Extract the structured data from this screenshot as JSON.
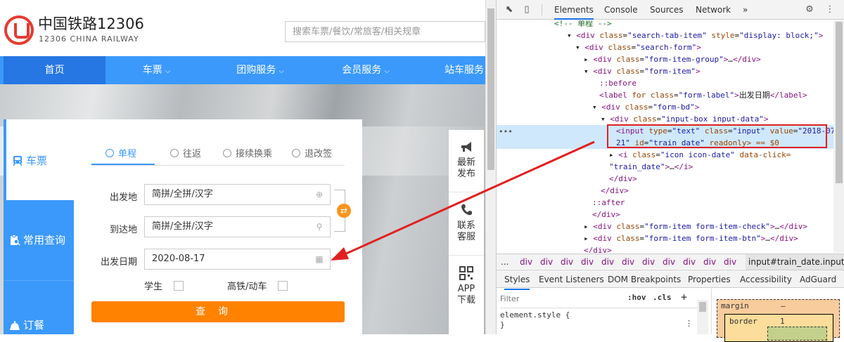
{
  "header": {
    "logo_cn": "中国铁路12306",
    "logo_en": "12306 CHINA RAILWAY",
    "search_placeholder": "搜索车票/餐饮/常旅客/相关规章"
  },
  "nav": {
    "items": [
      {
        "label": "首页",
        "chevron": false
      },
      {
        "label": "车票",
        "chevron": true
      },
      {
        "label": "团购服务",
        "chevron": true
      },
      {
        "label": "会员服务",
        "chevron": true
      },
      {
        "label": "站车服务",
        "chevron": false
      }
    ]
  },
  "side_tabs": [
    {
      "label": "车票",
      "icon": "train-icon"
    },
    {
      "label": "常用查询",
      "icon": "clipboard-search-icon"
    },
    {
      "label": "订餐",
      "icon": "bell-icon"
    }
  ],
  "booking": {
    "trip_tabs": [
      "单程",
      "往返",
      "接续换乘",
      "退改签"
    ],
    "from_label": "出发地",
    "from_placeholder": "简拼/全拼/汉字",
    "to_label": "到达地",
    "to_placeholder": "简拼/全拼/汉字",
    "date_label": "出发日期",
    "date_value": "2020-08-17",
    "student_label": "学生",
    "highspeed_label": "高铁/动车",
    "query_button": "查询"
  },
  "float_bar": [
    {
      "line1": "最新",
      "line2": "发布",
      "icon": "megaphone-icon"
    },
    {
      "line1": "联系",
      "line2": "客服",
      "icon": "phone-icon"
    },
    {
      "line1": "APP",
      "line2": "下载",
      "icon": "qr-code-icon"
    }
  ],
  "devtools": {
    "tabs": [
      "Elements",
      "Console",
      "Sources",
      "Network",
      "»"
    ],
    "dom_lines": {
      "l0": "<!-- 单程 -->",
      "l1_tag": "div",
      "l1_class": "search-tab-item",
      "l1_style": "display: block;",
      "l2_class": "search-form",
      "l3_class": "form-item-group",
      "l4_class": "form-item",
      "l5": "::before",
      "l6_label_class": "form-label",
      "l6_text": "出发日期",
      "l7_class": "form-bd",
      "l8_class": "input-box input-data",
      "l9_type": "text",
      "l9_class": "input",
      "l9_value_a": "2018-07-",
      "l10_value_b": "21",
      "l10_id": "train_date",
      "l10_suffix": "readonly> == $0",
      "l11_class": "icon icon-date",
      "l11_click": "data-click=",
      "l12_click_val": "\"train_date\"",
      "l15": "::after",
      "l17_class": "form-item form-item-check",
      "l18_class": "form-item form-item-btn"
    },
    "breadcrumb": [
      "...",
      "div",
      "div",
      "div",
      "div",
      "div",
      "div",
      "div",
      "div",
      "div",
      "div",
      "div",
      "input#train_date.input"
    ],
    "style_tabs": [
      "Styles",
      "Event Listeners",
      "DOM Breakpoints",
      "Properties",
      "Accessibility",
      "AdGuard"
    ],
    "filter_placeholder": "Filter",
    "hov": ":hov",
    "cls": ".cls",
    "plus": "+",
    "style_rule_selector": "element.style {",
    "style_rule_close": "}",
    "box_margin_label": "margin",
    "box_margin_value": "–",
    "box_border_label": "border",
    "box_border_value": "1"
  },
  "colors": {
    "nav_blue": "#3b99fc",
    "nav_active": "#2676e3",
    "query_orange": "#ff8200",
    "logo_red": "#e43c31",
    "annotation_red": "#e02020"
  }
}
